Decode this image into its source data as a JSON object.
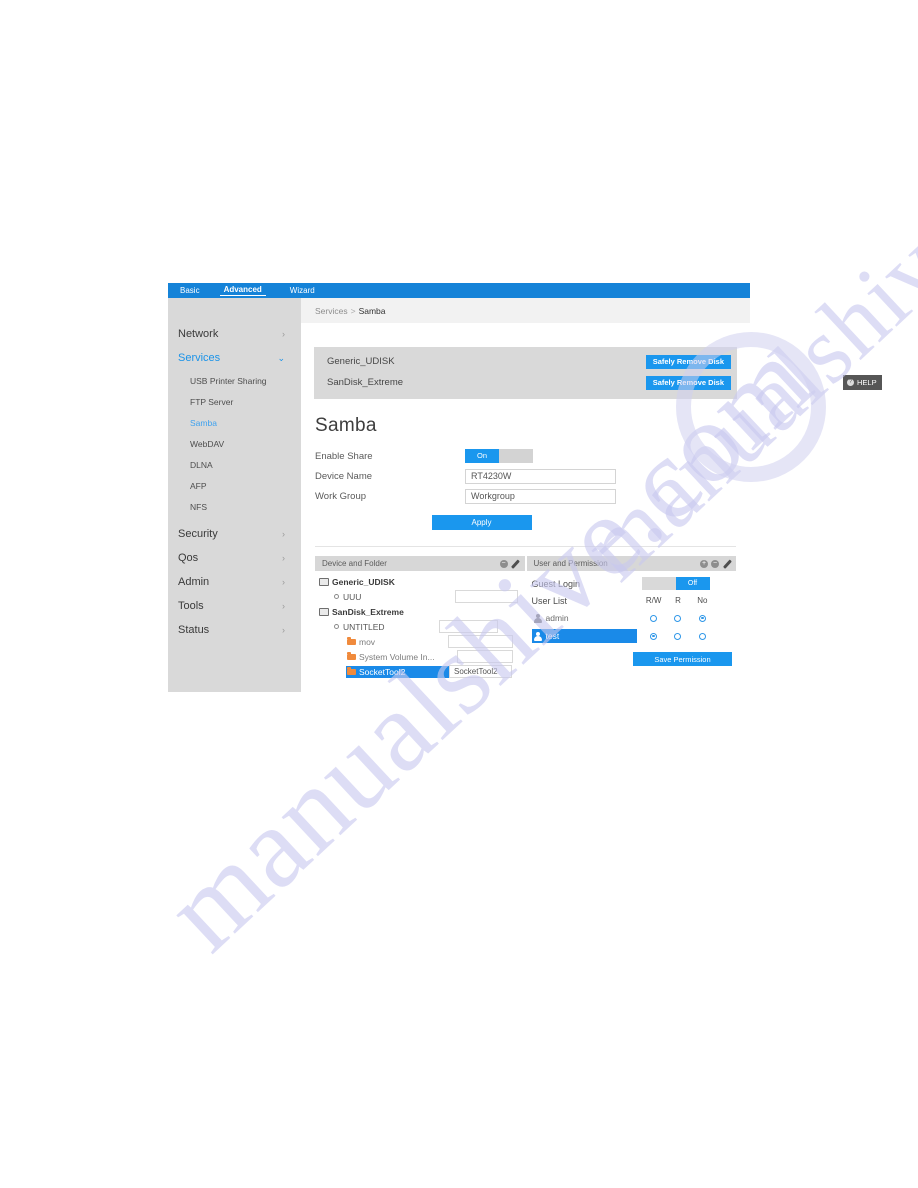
{
  "watermark": {
    "line1": "manualshive.com",
    "line2": "manualshive.com"
  },
  "topbar": {
    "tabs": [
      {
        "label": "Basic",
        "active": false
      },
      {
        "label": "Advanced",
        "active": true
      },
      {
        "label": "Wizard",
        "active": false
      }
    ]
  },
  "breadcrumb": {
    "parent": "Services",
    "separator": ">",
    "current": "Samba"
  },
  "help": {
    "icon": "question-icon",
    "glyph": "?",
    "label": "HELP"
  },
  "sidebar": {
    "groups": [
      {
        "label": "Network",
        "chevron": "›",
        "active": false
      },
      {
        "label": "Services",
        "chevron": "⌄",
        "active": true
      }
    ],
    "sub_items": [
      {
        "label": "USB Printer Sharing",
        "active": false
      },
      {
        "label": "FTP Server",
        "active": false
      },
      {
        "label": "Samba",
        "active": true
      },
      {
        "label": "WebDAV",
        "active": false
      },
      {
        "label": "DLNA",
        "active": false
      },
      {
        "label": "AFP",
        "active": false
      },
      {
        "label": "NFS",
        "active": false
      }
    ],
    "groups_after": [
      {
        "label": "Security",
        "chevron": "›"
      },
      {
        "label": "Qos",
        "chevron": "›"
      },
      {
        "label": "Admin",
        "chevron": "›"
      },
      {
        "label": "Tools",
        "chevron": "›"
      },
      {
        "label": "Status",
        "chevron": "›"
      }
    ]
  },
  "disks": {
    "rows": [
      {
        "name": "Generic_UDISK",
        "button": "Safely Remove Disk"
      },
      {
        "name": "SanDisk_Extreme",
        "button": "Safely Remove Disk"
      }
    ]
  },
  "samba": {
    "title": "Samba",
    "fields": {
      "enable_share_label": "Enable Share",
      "enable_share_state": "On",
      "device_name_label": "Device Name",
      "device_name_value": "RT4230W",
      "work_group_label": "Work Group",
      "work_group_value": "Workgroup"
    },
    "apply_label": "Apply"
  },
  "device_panel": {
    "title": "Device and Folder",
    "icons": [
      {
        "name": "remove-icon",
        "glyph": "−"
      },
      {
        "name": "edit-pencil-icon",
        "glyph": ""
      }
    ],
    "tree": [
      {
        "level": 0,
        "icon": "disk-icon",
        "label": "Generic_UDISK",
        "kind": "dev",
        "selected": false,
        "input": null
      },
      {
        "level": 1,
        "icon": "volume-icon",
        "label": "UUU",
        "kind": "vol",
        "selected": false,
        "input": ""
      },
      {
        "level": 0,
        "icon": "disk-icon",
        "label": "SanDisk_Extreme",
        "kind": "dev",
        "selected": false,
        "input": null
      },
      {
        "level": 1,
        "icon": "volume-icon",
        "label": "UNTITLED",
        "kind": "vol",
        "selected": false,
        "input": ""
      },
      {
        "level": 2,
        "icon": "folder-icon",
        "label": "mov",
        "kind": "fold",
        "selected": false,
        "input": ""
      },
      {
        "level": 2,
        "icon": "folder-icon",
        "label": "System Volume In...",
        "kind": "fold",
        "selected": false,
        "input": ""
      },
      {
        "level": 2,
        "icon": "folder-icon",
        "label": "SocketTool2",
        "kind": "fold",
        "selected": true,
        "input": "SocketTool2"
      }
    ]
  },
  "permission_panel": {
    "title": "User and Permission",
    "icons": [
      {
        "name": "add-icon",
        "glyph": "+"
      },
      {
        "name": "remove-icon",
        "glyph": "−"
      },
      {
        "name": "edit-pencil-icon",
        "glyph": ""
      }
    ],
    "guest_login_label": "Guest Login",
    "guest_login_state": "Off",
    "user_list_label": "User List",
    "perm_columns": [
      "R/W",
      "R",
      "No"
    ],
    "users": [
      {
        "name": "admin",
        "selected": false,
        "permission": "No"
      },
      {
        "name": "test",
        "selected": true,
        "permission": "R/W"
      }
    ],
    "save_label": "Save Permission"
  },
  "colors": {
    "accent": "#1a97ee",
    "topbar": "#1583d8",
    "sidebar_bg": "#d9d9d9",
    "panel_head": "#d7d7d7",
    "select_blue": "#1a8ae8",
    "folder_orange": "#f08a3c"
  }
}
